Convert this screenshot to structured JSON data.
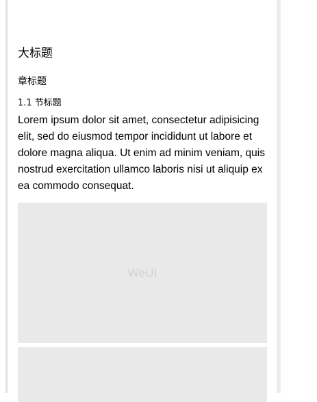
{
  "article": {
    "title": "大标题",
    "chapter_title": "章标题",
    "section_title": "1.1 节标题",
    "paragraph": "Lorem ipsum dolor sit amet, consectetur adipisicing elit, sed do eiusmod tempor incididunt ut labore et dolore magna aliqua. Ut enim ad minim veniam, quis nostrud exercitation ullamco laboris nisi ut aliquip ex ea commodo consequat.",
    "image_placeholder_label": "WeUI"
  }
}
